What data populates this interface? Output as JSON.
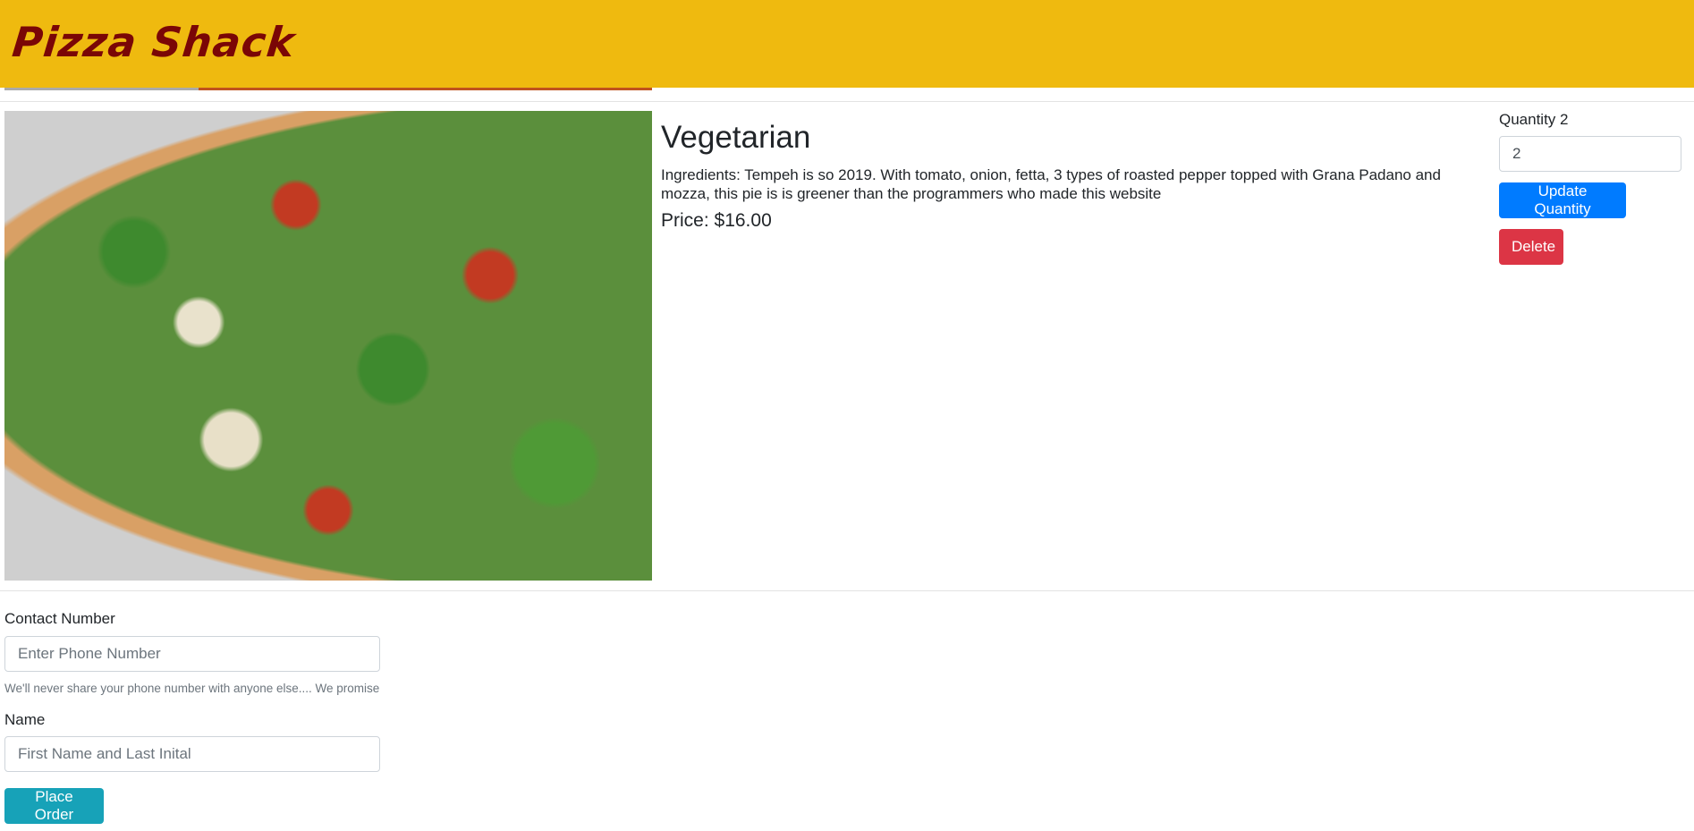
{
  "header": {
    "brand": "Pizza Shack"
  },
  "cart_item": {
    "name": "Vegetarian",
    "ingredients": "Ingredients: Tempeh is so 2019. With tomato, onion, fetta, 3 types of roasted pepper topped with Grana Padano and mozza, this pie is is greener than the programmers who made this website",
    "price": "Price: $16.00",
    "quantity_label": "Quantity 2",
    "quantity_value": "2",
    "update_label": "Update Quantity",
    "delete_label": "Delete"
  },
  "order_form": {
    "contact_label": "Contact Number",
    "contact_placeholder": "Enter Phone Number",
    "contact_help": "We'll never share your phone number with anyone else.... We promise",
    "name_label": "Name",
    "name_placeholder": "First Name and Last Inital",
    "submit_label": "Place Order"
  },
  "colors": {
    "header": "#efba0f",
    "brand": "#7a0606",
    "primary": "#007bff",
    "danger": "#dc3545",
    "info": "#17a2b8"
  }
}
